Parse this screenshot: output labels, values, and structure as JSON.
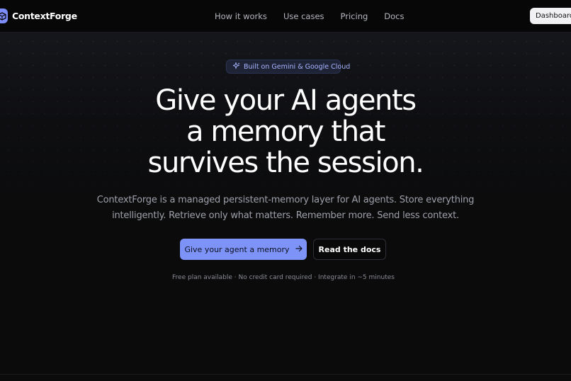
{
  "brand": {
    "name": "ContextForge",
    "logo_icon": "cube-icon",
    "accent_color": "#7c8cf8"
  },
  "nav": {
    "links": [
      "How it works",
      "Use cases",
      "Pricing",
      "Docs"
    ],
    "dashboard_label": "Dashboard"
  },
  "hero": {
    "badge_icon": "sparkles-icon",
    "badge_text": "Built on Gemini & Google Cloud",
    "headline_lines": [
      "Give your AI agents",
      "a memory that",
      "survives the session."
    ],
    "subtext_lines": [
      "ContextForge is a managed persistent-memory layer for AI agents. Store everything",
      "intelligently. Retrieve only what matters. Remember more. Send less context."
    ],
    "primary_cta": "Give your agent a memory",
    "primary_cta_icon": "arrow-right-icon",
    "secondary_cta": "Read the docs",
    "fineprint": "Free plan available · No credit card required · Integrate in ~5 minutes"
  }
}
